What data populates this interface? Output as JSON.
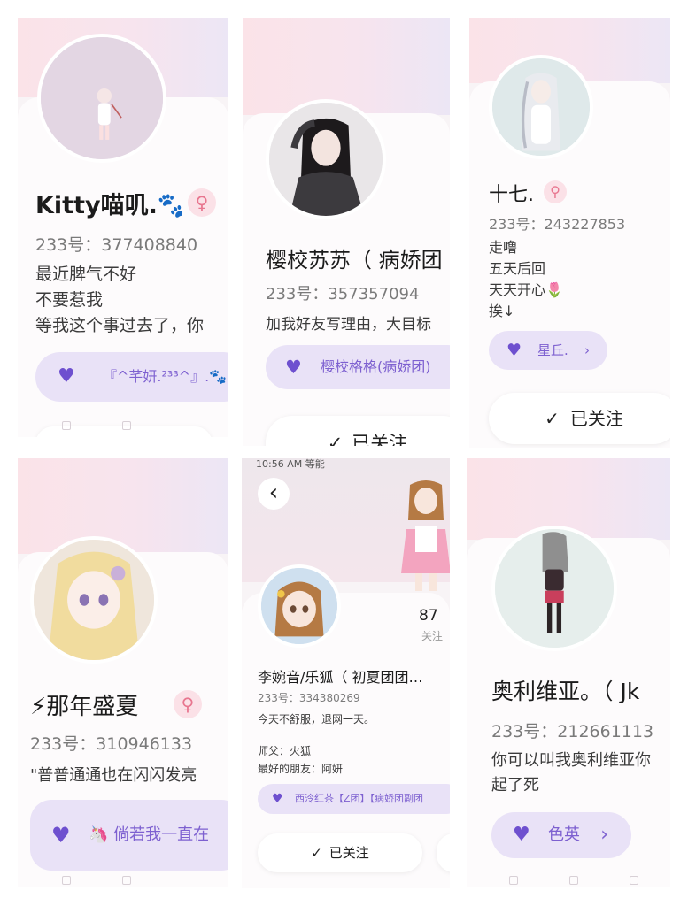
{
  "cards": [
    {
      "name": "Kitty喵叽.🐾",
      "uid": "233号：377408840",
      "bio": "最近脾气不好\n不要惹我\n等我这个事过去了，你",
      "gender_glyph": "♀",
      "pill": "『^芊妍.²³³^』.🐾",
      "pill_icon": "heart-icon"
    },
    {
      "name": "樱校苏苏（ 病娇团",
      "uid": "233号：357357094",
      "bio": "加我好友写理由，大目标",
      "pill": "樱校格格(病娇团)",
      "pill_icon": "heart-icon",
      "follow": "已关注"
    },
    {
      "name": "十七.",
      "uid": "233号：243227853",
      "bio": "走噜\n五天后回\n天天开心🌷\n挨↓",
      "gender_glyph": "♀",
      "pill": "星丘.",
      "pill_icon": "heart-icon",
      "follow": "已关注"
    },
    {
      "name": "⚡那年盛夏",
      "uid": "233号：310946133",
      "bio": "\"普普通通也在闪闪发亮",
      "gender_glyph": "♀",
      "pill": "🦄  倘若我一直在",
      "pill_icon": "heart-icon"
    },
    {
      "status_time": "10:56 AM 等能",
      "name": "李婉音/乐狐（ 初夏团团…",
      "uid": "233号：334380269",
      "bio": "今天不舒服，退网一天。",
      "master": "师父：火狐",
      "best_friend": "最好的朋友：阿妍",
      "stat_value": "87",
      "stat_label": "关注",
      "pill": "西泠红茶【Z团】【病娇团副团",
      "pill_icon": "heart-icon",
      "follow": "已关注",
      "back_glyph": "‹"
    },
    {
      "name": "奥利维亚。（ Jk",
      "uid": "233号：212661113",
      "bio": "你可以叫我奥利维亚你\n起了死",
      "pill": "色英",
      "pill_icon": "heart-icon"
    }
  ],
  "colors": {
    "accent": "#7d60d0",
    "female_badge": "#e8768f",
    "pill_bg": "#e9e2f7"
  }
}
